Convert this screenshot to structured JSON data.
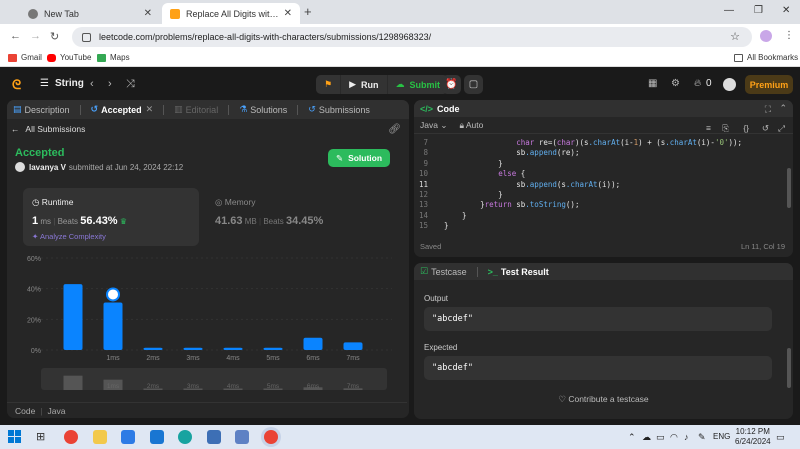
{
  "browser": {
    "tabs": [
      {
        "title": "New Tab",
        "active": false
      },
      {
        "title": "Replace All Digits with Characte",
        "active": true
      }
    ],
    "url": "leetcode.com/problems/replace-all-digits-with-characters/submissions/1298968323/",
    "bookmarks": [
      "Gmail",
      "YouTube",
      "Maps"
    ],
    "all_bookmarks": "All Bookmarks"
  },
  "lc_nav": {
    "problem_list": "String",
    "run": "Run",
    "submit": "Submit",
    "fire_count": "0",
    "premium": "Premium"
  },
  "left_panel": {
    "tabs": [
      "Description",
      "Accepted",
      "Editorial",
      "Solutions",
      "Submissions"
    ],
    "all_submissions": "All Submissions",
    "status": "Accepted",
    "user": "lavanya V",
    "submitted_text": "submitted at Jun 24, 2024 22:12",
    "solution_button": "Solution",
    "runtime": {
      "label": "Runtime",
      "value": "1",
      "unit": "ms",
      "beats_label": "Beats",
      "beats": "56.43%",
      "analyze": "Analyze Complexity"
    },
    "memory": {
      "label": "Memory",
      "value": "41.63",
      "unit": "MB",
      "beats_label": "Beats",
      "beats": "34.45%"
    },
    "code_footer": [
      "Code",
      "Java"
    ]
  },
  "chart_data": {
    "type": "bar",
    "categories": [
      "0ms",
      "1ms",
      "2ms",
      "3ms",
      "4ms",
      "5ms",
      "6ms",
      "7ms"
    ],
    "tick_labels": [
      "1ms",
      "2ms",
      "3ms",
      "4ms",
      "5ms",
      "6ms",
      "7ms"
    ],
    "values": [
      43,
      31,
      1.5,
      1.5,
      1.5,
      1.5,
      8,
      5
    ],
    "y_ticks": [
      "60%",
      "40%",
      "20%",
      "0%"
    ],
    "ylim": [
      0,
      60
    ],
    "highlight_category": "1ms",
    "accent": "#0a84ff"
  },
  "code_panel": {
    "title": "Code",
    "language": "Java",
    "mode": "Auto",
    "lines": [
      {
        "n": "7",
        "text": "                char re=(char)(s.charAt(i-1) + (s.charAt(i)-'0'));"
      },
      {
        "n": "8",
        "text": "                sb.append(re);"
      },
      {
        "n": "9",
        "text": "            }"
      },
      {
        "n": "10",
        "text": "            else {"
      },
      {
        "n": "11",
        "text": "                sb.append(s.charAt(i));"
      },
      {
        "n": "12",
        "text": "            }"
      },
      {
        "n": "13",
        "text": "        }return sb.toString();"
      },
      {
        "n": "14",
        "text": "    }"
      },
      {
        "n": "15",
        "text": "}"
      }
    ],
    "saved": "Saved",
    "cursor": "Ln 11, Col 19"
  },
  "test_panel": {
    "tabs": [
      "Testcase",
      "Test Result"
    ],
    "output_label": "Output",
    "output_value": "\"abcdef\"",
    "expected_label": "Expected",
    "expected_value": "\"abcdef\"",
    "contribute": "Contribute a testcase"
  },
  "taskbar": {
    "lang": "ENG",
    "time": "10:12 PM",
    "date": "6/24/2024"
  }
}
